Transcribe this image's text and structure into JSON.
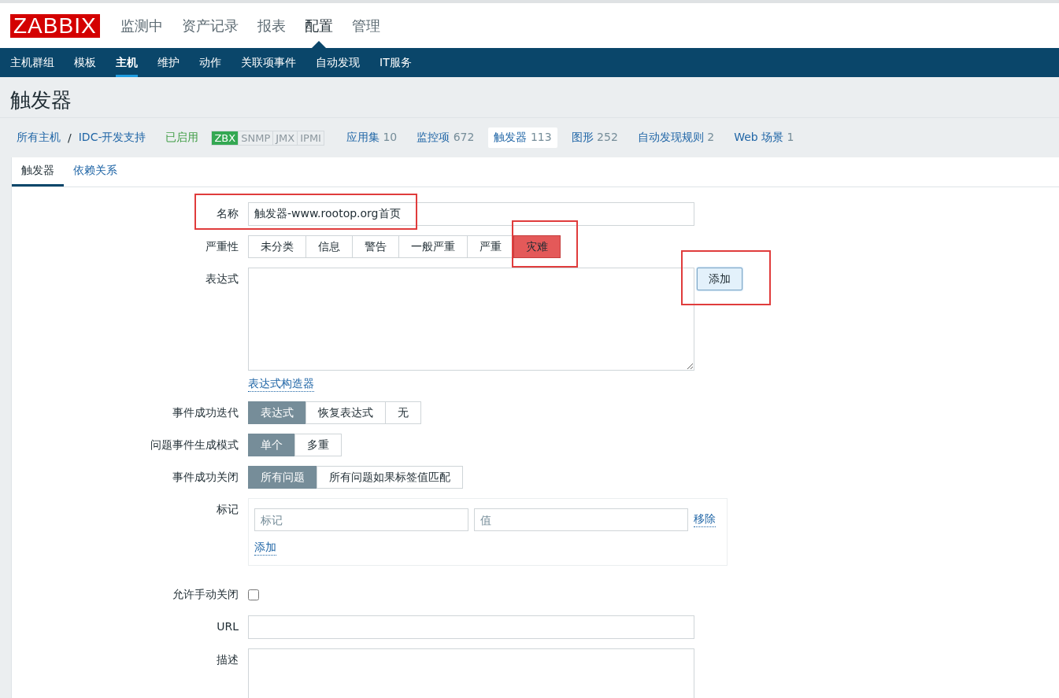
{
  "header": {
    "logo": "ZABBIX",
    "menu": [
      {
        "label": "监测中",
        "selected": false
      },
      {
        "label": "资产记录",
        "selected": false
      },
      {
        "label": "报表",
        "selected": false
      },
      {
        "label": "配置",
        "selected": true
      },
      {
        "label": "管理",
        "selected": false
      }
    ]
  },
  "subnav": [
    {
      "label": "主机群组",
      "selected": false
    },
    {
      "label": "模板",
      "selected": false
    },
    {
      "label": "主机",
      "selected": true
    },
    {
      "label": "维护",
      "selected": false
    },
    {
      "label": "动作",
      "selected": false
    },
    {
      "label": "关联项事件",
      "selected": false
    },
    {
      "label": "自动发现",
      "selected": false
    },
    {
      "label": "IT服务",
      "selected": false
    }
  ],
  "page_title": "触发器",
  "breadcrumb": {
    "items": [
      "所有主机",
      "IDC-开发支持"
    ],
    "separator": "/",
    "status": "已启用",
    "availability": [
      {
        "label": "ZBX",
        "on": true
      },
      {
        "label": "SNMP",
        "on": false
      },
      {
        "label": "JMX",
        "on": false
      },
      {
        "label": "IPMI",
        "on": false
      }
    ],
    "links": [
      {
        "label": "应用集",
        "count": "10",
        "selected": false
      },
      {
        "label": "监控项",
        "count": "672",
        "selected": false
      },
      {
        "label": "触发器",
        "count": "113",
        "selected": true
      },
      {
        "label": "图形",
        "count": "252",
        "selected": false
      },
      {
        "label": "自动发现规则",
        "count": "2",
        "selected": false
      },
      {
        "label": "Web 场景",
        "count": "1",
        "selected": false
      }
    ]
  },
  "tabs": [
    {
      "label": "触发器",
      "selected": true
    },
    {
      "label": "依赖关系",
      "selected": false
    }
  ],
  "form": {
    "name": {
      "label": "名称",
      "value": "触发器-www.rootop.org首页"
    },
    "severity": {
      "label": "严重性",
      "options": [
        {
          "label": "未分类",
          "selected": false
        },
        {
          "label": "信息",
          "selected": false
        },
        {
          "label": "警告",
          "selected": false
        },
        {
          "label": "一般严重",
          "selected": false
        },
        {
          "label": "严重",
          "selected": false
        },
        {
          "label": "灾难",
          "selected": true
        }
      ]
    },
    "expression": {
      "label": "表达式",
      "add_button": "添加",
      "builder_link": "表达式构造器"
    },
    "radio_groups": [
      {
        "label": "事件成功迭代",
        "options": [
          {
            "label": "表达式",
            "selected": true
          },
          {
            "label": "恢复表达式",
            "selected": false
          },
          {
            "label": "无",
            "selected": false
          }
        ]
      },
      {
        "label": "问题事件生成模式",
        "options": [
          {
            "label": "单个",
            "selected": true
          },
          {
            "label": "多重",
            "selected": false
          }
        ]
      },
      {
        "label": "事件成功关闭",
        "options": [
          {
            "label": "所有问题",
            "selected": true
          },
          {
            "label": "所有问题如果标签值匹配",
            "selected": false
          }
        ]
      }
    ],
    "tags": {
      "label": "标记",
      "rows": [
        {
          "tag_placeholder": "标记",
          "value_placeholder": "值",
          "remove": "移除"
        }
      ],
      "add": "添加"
    },
    "manual_close": {
      "label": "允许手动关闭",
      "checked": false
    },
    "url": {
      "label": "URL"
    },
    "description": {
      "label": "描述"
    }
  }
}
